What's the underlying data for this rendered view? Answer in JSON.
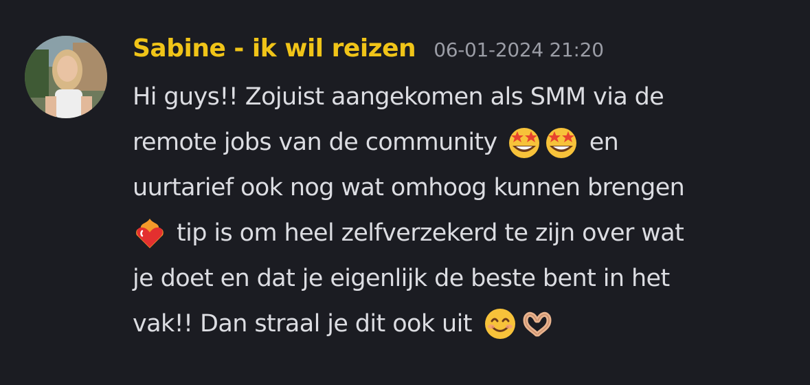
{
  "message": {
    "author": "Sabine - ik wil reizen",
    "timestamp": "06-01-2024 21:20",
    "author_color": "#f0c418",
    "lines": [
      "Hi guys!! Zojuist aangekomen als SMM via de",
      "remote jobs van de community",
      "en",
      "uurtarief ook nog wat omhoog kunnen brengen",
      "tip is om heel zelfverzekerd te zijn over wat",
      "je doet en dat je eigenlijk de beste bent in het",
      "vak!! Dan straal je dit ook uit"
    ],
    "emojis": {
      "star_struck": "star-struck-emoji",
      "heart_on_fire": "heart-on-fire-emoji",
      "smiling_face": "smiling-face-emoji",
      "heart_hands": "heart-hands-emoji"
    }
  }
}
